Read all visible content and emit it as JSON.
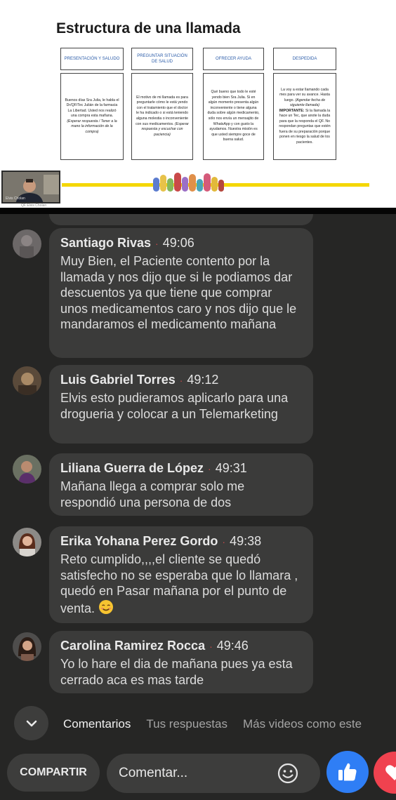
{
  "slide": {
    "title": "Estructura de una llamada",
    "columns": [
      {
        "heading": "PRESENTACIÓN Y SALUDO",
        "body": "Buenos días Sra Julia, le habla el Dr/QF/Tec Julián de la farmacia La Libertad. Usted nos realizó una compra esta mañana.",
        "note": "(Esperar respuesta / Tener a la mano la información de la compra)"
      },
      {
        "heading": "PREGUNTAR SITUACIÓN DE SALUD",
        "body": "El motivo de mi llamada es para preguntarle cómo le está yendo con el tratamiento que el doctor le ha indicado o si está teniendo alguna molestia o inconveniente con sus medicamentos.",
        "note": "(Esperar respuesta y escuchar con paciencia)"
      },
      {
        "heading": "OFRECER AYUDA",
        "body": "Qué bueno que todo le esté yendo bien Sra Julia. Si en algún momento presenta algún inconveniente o tiene alguna duda sobre algún medicamento, sólo nos envía un mensajito de WhatsApp y con gusto la ayudamos. Nuestra misión es que usted siempre goce de buena salud."
      },
      {
        "heading": "DESPEDIDA",
        "body": "La voy a estar llamando cada mes para ver su avance. Hasta luego.",
        "note": "(Agendar fecha de siguiente llamada)",
        "important_label": "IMPORTANTE:",
        "important_text": "Si la llamada la hace un Tec, que anote la duda para que la responda el QF. No respondan preguntas que estén fuera de su preparación porque ponen en riesgo la salud de los pacientes."
      }
    ],
    "pip_label": "Elvis Cholan",
    "pip_sublabel": "QF Elvis Cholan"
  },
  "comments": [
    {
      "name": "Santiago Rivas",
      "time": "49:06",
      "text": "Muy Bien, el Paciente contento por la llamada y nos dijo que si le podiamos dar descuentos ya que tiene que comprar unos medicamentos caro y nos dijo que le mandaramos el medicamento mañana"
    },
    {
      "name": "Luis Gabriel Torres",
      "time": "49:12",
      "text": "Elvis esto pudieramos aplicarlo para una drogueria y colocar a un Telemarketing"
    },
    {
      "name": "Liliana Guerra de López",
      "time": "49:31",
      "text": "Mañana llega a comprar solo me respondió una persona de dos"
    },
    {
      "name": "Erika Yohana Perez Gordo",
      "time": "49:38",
      "text": "Reto cumplido,,,,el cliente se quedó satisfecho no se esperaba que lo llamara , quedó en Pasar mañana por el punto de venta.",
      "emoji": "smiling-face-emoji"
    },
    {
      "name": "Carolina Ramirez Rocca",
      "time": "49:46",
      "text": "Yo lo hare el dia de mañana pues ya esta cerrado aca es mas tarde"
    }
  ],
  "tabs": [
    {
      "label": "Comentarios",
      "active": true
    },
    {
      "label": "Tus respuestas",
      "active": false
    },
    {
      "label": "Más videos como este",
      "active": false
    }
  ],
  "actions": {
    "share_label": "COMPARTIR",
    "comment_placeholder": "Comentar...",
    "icons": [
      "chevron-down-icon",
      "emoji-icon",
      "like-icon",
      "love-icon"
    ]
  },
  "colors": {
    "background": "#262625",
    "bubble": "#3b3b3a",
    "timestamp_dot": "#c84a4a",
    "like_blue": "#2f7ef5",
    "love_red": "#f0424f",
    "slide_accent": "#f4d700"
  }
}
